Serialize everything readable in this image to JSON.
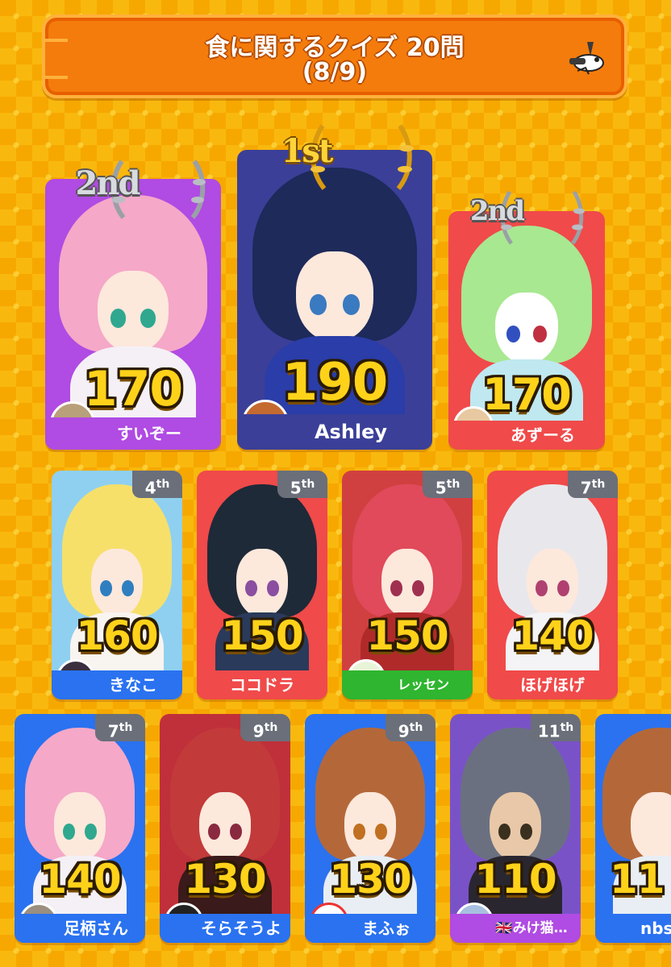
{
  "header": {
    "title": "食に関するクイズ 20問",
    "progress": "(8/9)",
    "mascot_icon": "mascot-icon"
  },
  "top3": [
    {
      "rank_label": "1st",
      "score": "190",
      "name": "Ashley",
      "color": "#3b3f98"
    },
    {
      "rank_label": "2nd",
      "score": "170",
      "name": "すいぞー",
      "color": "#b04be3"
    },
    {
      "rank_label": "2nd",
      "score": "170",
      "name": "あずーる",
      "color": "#f04a4a"
    }
  ],
  "row2": [
    {
      "rank": "4",
      "suffix": "th",
      "score": "160",
      "name": "きなこ",
      "color": "#2a72f0"
    },
    {
      "rank": "5",
      "suffix": "th",
      "score": "150",
      "name": "ココドラ",
      "color": "#f04a4a"
    },
    {
      "rank": "5",
      "suffix": "th",
      "score": "150",
      "name": "レッセン",
      "color": "#2fb52f"
    },
    {
      "rank": "7",
      "suffix": "th",
      "score": "140",
      "name": "ほげほげ",
      "color": "#f04a4a"
    }
  ],
  "row3": [
    {
      "rank": "7",
      "suffix": "th",
      "score": "140",
      "name": "足柄さん",
      "color": "#2a72f0"
    },
    {
      "rank": "9",
      "suffix": "th",
      "score": "130",
      "name": "そらそうよ",
      "color": "#2a72f0"
    },
    {
      "rank": "9",
      "suffix": "th",
      "score": "130",
      "name": "まふぉ",
      "color": "#2a72f0"
    },
    {
      "rank": "11",
      "suffix": "th",
      "score": "110",
      "name": "🇬🇧みけ猫…",
      "color": "#b04be3"
    },
    {
      "rank": "",
      "suffix": "",
      "score": "11",
      "name": "nbs",
      "color": "#2a72f0"
    }
  ]
}
